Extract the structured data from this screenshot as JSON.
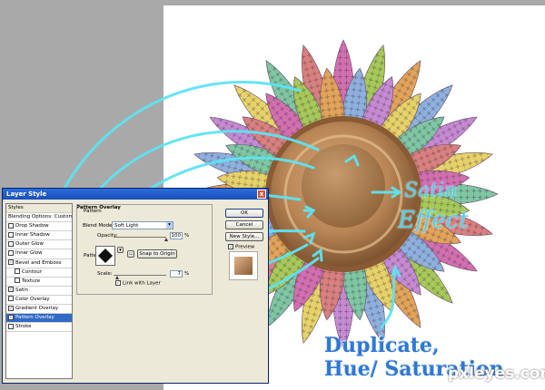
{
  "dialog": {
    "title": "Layer Style",
    "close_symbol": "x",
    "styles_header": "Styles",
    "style_items": [
      {
        "label": "Blending Options: Custom",
        "checkbox": false,
        "checked": false,
        "selected": false,
        "sub": false
      },
      {
        "label": "Drop Shadow",
        "checkbox": true,
        "checked": false,
        "selected": false,
        "sub": false
      },
      {
        "label": "Inner Shadow",
        "checkbox": true,
        "checked": false,
        "selected": false,
        "sub": false
      },
      {
        "label": "Outer Glow",
        "checkbox": true,
        "checked": false,
        "selected": false,
        "sub": false
      },
      {
        "label": "Inner Glow",
        "checkbox": true,
        "checked": false,
        "selected": false,
        "sub": false
      },
      {
        "label": "Bevel and Emboss",
        "checkbox": true,
        "checked": true,
        "selected": false,
        "sub": false
      },
      {
        "label": "Contour",
        "checkbox": true,
        "checked": false,
        "selected": false,
        "sub": true
      },
      {
        "label": "Texture",
        "checkbox": true,
        "checked": false,
        "selected": false,
        "sub": true
      },
      {
        "label": "Satin",
        "checkbox": true,
        "checked": true,
        "selected": false,
        "sub": false
      },
      {
        "label": "Color Overlay",
        "checkbox": true,
        "checked": false,
        "selected": false,
        "sub": false
      },
      {
        "label": "Gradient Overlay",
        "checkbox": true,
        "checked": true,
        "selected": false,
        "sub": false
      },
      {
        "label": "Pattern Overlay",
        "checkbox": true,
        "checked": true,
        "selected": true,
        "sub": false
      },
      {
        "label": "Stroke",
        "checkbox": true,
        "checked": false,
        "selected": false,
        "sub": false
      }
    ],
    "section_title": "Pattern Overlay",
    "group_title": "Pattern",
    "blend_mode_label": "Blend Mode:",
    "blend_mode_value": "Soft Light",
    "opacity_label": "Opacity:",
    "opacity_value": "100",
    "opacity_unit": "%",
    "opacity_fraction": 1.0,
    "pattern_label": "Pattern:",
    "snap_button": "Snap to Origin",
    "scale_label": "Scale:",
    "scale_value": "7",
    "scale_unit": "%",
    "scale_fraction": 0.07,
    "link_label": "Link with Layer",
    "link_checked": true,
    "ok_button": "OK",
    "cancel_button": "Cancel",
    "new_style_button": "New Style...",
    "preview_label": "Preview",
    "preview_checked": true
  },
  "annotations": {
    "satin_line1": "Satin",
    "satin_line2": "Effect",
    "caption_line1": "Duplicate,",
    "caption_line2": "Hue/ Saturation"
  },
  "watermark": "pxleyes.com",
  "colors": {
    "accent_cyan": "#4fd0ec",
    "caption_blue": "#2f78d2",
    "selection_blue": "#316ac5",
    "titlebar_blue": "#1a4eb8"
  }
}
